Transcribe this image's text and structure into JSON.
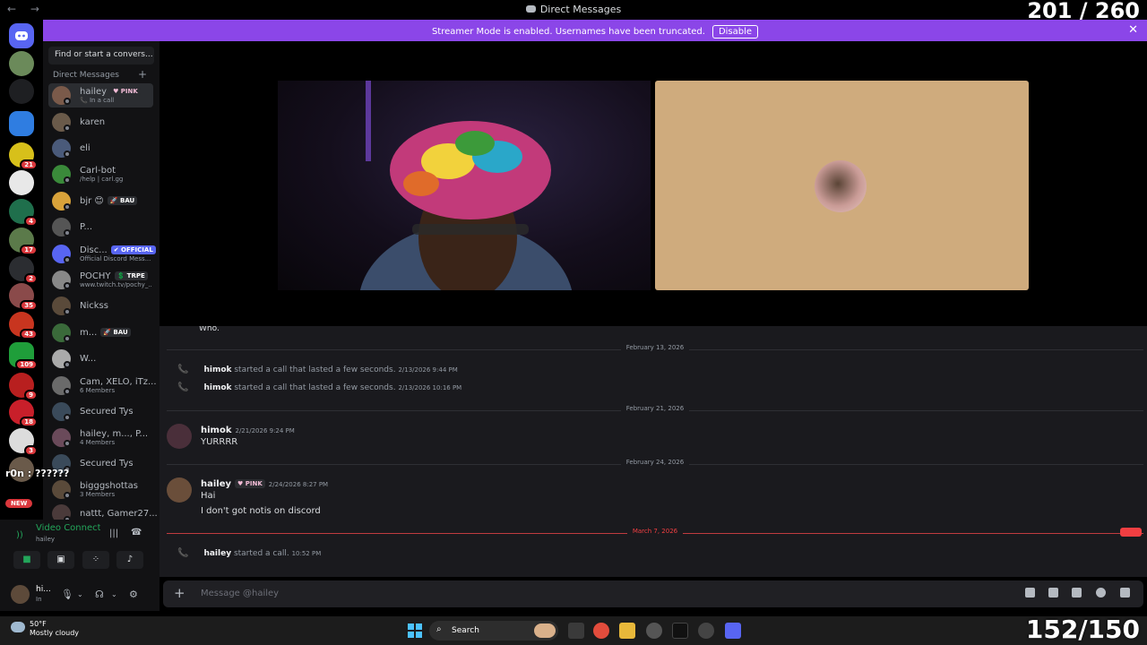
{
  "window": {
    "title": "Direct Messages",
    "nav": "← →"
  },
  "overlay": {
    "counter_top": "201 / 260",
    "counter_bottom": "152/150",
    "chat_ticker": "r0n : ??????"
  },
  "banner": {
    "message": "Streamer Mode is enabled. Usernames have been truncated.",
    "button": "Disable",
    "close": "✕"
  },
  "servers": {
    "badges": [
      "21",
      "4",
      "17",
      "2",
      "35",
      "43",
      "109",
      "9",
      "18",
      "3"
    ],
    "new_label": "NEW"
  },
  "dm_panel": {
    "search_placeholder": "Find or start a convers...",
    "header": "Direct Messages",
    "add": "+",
    "items": [
      {
        "name": "hailey",
        "tag": "♥ PINK",
        "sub": "📞 In a call"
      },
      {
        "name": "karen",
        "tag": "",
        "sub": ""
      },
      {
        "name": "eli",
        "tag": "",
        "sub": ""
      },
      {
        "name": "Carl-bot",
        "tag": "",
        "sub": "/help | carl.gg"
      },
      {
        "name": "bjr 😊",
        "tag": "🚀 BAU",
        "sub": ""
      },
      {
        "name": "P...",
        "tag": "",
        "sub": ""
      },
      {
        "name": "Disc...",
        "tag": "✔ OFFICIAL",
        "sub": "Official Discord Mess..."
      },
      {
        "name": "POCHY",
        "tag": "💲 TRPE",
        "sub": "www.twitch.tv/pochy_..."
      },
      {
        "name": "Nickss",
        "tag": "",
        "sub": ""
      },
      {
        "name": "m...",
        "tag": "🚀 BAU",
        "sub": ""
      },
      {
        "name": "W...",
        "tag": "",
        "sub": ""
      },
      {
        "name": "Cam, XELO, iTz...",
        "tag": "",
        "sub": "6 Members"
      },
      {
        "name": "Secured Tys",
        "tag": "",
        "sub": ""
      },
      {
        "name": "hailey, m..., P...",
        "tag": "",
        "sub": "4 Members"
      },
      {
        "name": "Secured Tys",
        "tag": "",
        "sub": ""
      },
      {
        "name": "bigggshottas",
        "tag": "",
        "sub": "3 Members"
      },
      {
        "name": "nattt, Gamer27...",
        "tag": "",
        "sub": ""
      }
    ]
  },
  "voice_panel": {
    "status": "Video Connected",
    "channel": "hailey"
  },
  "user_panel": {
    "name": "hi...",
    "status": "In"
  },
  "chat": {
    "truncated_top": "Who.",
    "dividers": [
      "February 13, 2026",
      "February 21, 2026",
      "February 24, 2026",
      "March 7, 2026"
    ],
    "new_pill": "NEW",
    "system": [
      {
        "who": "himok",
        "text": " started a call that lasted a few seconds. ",
        "ts": "2/13/2026 9:44 PM"
      },
      {
        "who": "himok",
        "text": " started a call that lasted a few seconds. ",
        "ts": "2/13/2026 10:16 PM"
      },
      {
        "who": "hailey",
        "text": " started a call. ",
        "ts": "10:52 PM"
      }
    ],
    "messages": [
      {
        "author": "himok",
        "tag": "",
        "ts": "2/21/2026 9:24 PM",
        "lines": [
          "YURRRR"
        ]
      },
      {
        "author": "hailey",
        "tag": "♥ PINK",
        "ts": "2/24/2026 8:27 PM",
        "lines": [
          "Hai",
          "I don't got notis on discord"
        ]
      }
    ],
    "composer_placeholder": "Message @hailey"
  },
  "taskbar": {
    "temp": "50°F",
    "condition": "Mostly cloudy",
    "search": "Search"
  },
  "colors": {
    "accent": "#8b46e8",
    "online": "#23a55a",
    "danger": "#f23f42",
    "blurple": "#5865f2"
  }
}
